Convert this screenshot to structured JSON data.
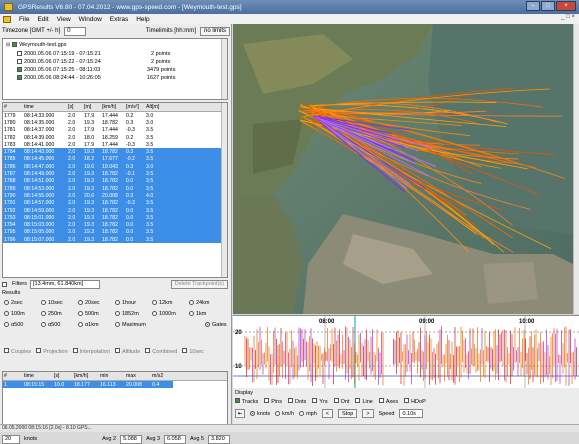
{
  "window": {
    "title": "GPSResults V6.80 - 07.04.2012 - www.gps-speed.com - [Weymouth-test.gps]"
  },
  "menu": {
    "items": [
      "File",
      "Edit",
      "View",
      "Window",
      "Extras",
      "Help"
    ],
    "right": "_ □ ×"
  },
  "timezone": {
    "label": "Timezone [GMT +/- h]",
    "value": "0",
    "timelimits": "Timelimits [hh:mm]",
    "nolimits": "no limits"
  },
  "tree": {
    "root": "Weymouth-test.gps",
    "tracks": [
      {
        "label": "2000.05.06 07:15:19 - 07:15:21",
        "points": "2 points"
      },
      {
        "label": "2000.05.06 07:15:22 - 07:15:24",
        "points": "2 points"
      },
      {
        "label": "2000.05.06 07:15:25 - 08:11:03",
        "points": "3479 points"
      },
      {
        "label": "2000.05.06 08:24:44 - 10:26:05",
        "points": "1627 points"
      }
    ]
  },
  "points_table": {
    "headers": [
      "#",
      "time",
      "[s]",
      "[m]",
      "[km/h]",
      "[m/s²]",
      "Alt[m]"
    ],
    "rows": [
      [
        "1779",
        "08:14:33.000",
        "2.0",
        "17.9",
        "17.444",
        "0.2",
        "3.0"
      ],
      [
        "1780",
        "08:14:35.000",
        "2.0",
        "19.3",
        "18.782",
        "0.3",
        "3.0"
      ],
      [
        "1781",
        "08:14:37.000",
        "2.0",
        "17.9",
        "17.444",
        "-0.3",
        "3.5"
      ],
      [
        "1782",
        "08:14:39.000",
        "2.0",
        "18.0",
        "18.259",
        "0.2",
        "3.5"
      ],
      [
        "1783",
        "08:14:41.000",
        "2.0",
        "17.9",
        "17.444",
        "-0.3",
        "3.5"
      ],
      [
        "1784",
        "08:14:43.000",
        "2.0",
        "19.3",
        "18.782",
        "0.3",
        "3.5"
      ],
      [
        "1785",
        "08:14:45.000",
        "2.0",
        "18.2",
        "17.677",
        "-0.2",
        "3.5"
      ],
      [
        "1786",
        "08:14:47.000",
        "2.0",
        "19.6",
        "19.043",
        "0.3",
        "3.0"
      ],
      [
        "1787",
        "08:14:49.000",
        "2.0",
        "19.3",
        "18.782",
        "-0.1",
        "3.5"
      ],
      [
        "1788",
        "08:14:51.000",
        "2.0",
        "19.3",
        "18.782",
        "0.0",
        "3.5"
      ],
      [
        "1789",
        "08:14:53.000",
        "2.0",
        "19.3",
        "18.782",
        "0.0",
        "3.5"
      ],
      [
        "1790",
        "08:14:55.000",
        "2.0",
        "20.6",
        "20.008",
        "0.3",
        "4.0"
      ],
      [
        "1791",
        "08:14:57.000",
        "2.0",
        "19.3",
        "18.782",
        "-0.3",
        "3.5"
      ],
      [
        "1792",
        "08:14:59.000",
        "2.0",
        "19.3",
        "18.782",
        "0.0",
        "3.5"
      ],
      [
        "1793",
        "08:15:01.000",
        "2.0",
        "19.3",
        "18.782",
        "0.0",
        "3.5"
      ],
      [
        "1794",
        "08:15:03.000",
        "2.0",
        "19.3",
        "18.782",
        "0.0",
        "3.5"
      ],
      [
        "1795",
        "08:15:05.000",
        "2.0",
        "19.3",
        "18.782",
        "0.0",
        "3.5"
      ],
      [
        "1796",
        "08:15:07.000",
        "2.0",
        "19.3",
        "18.782",
        "0.0",
        "3.5"
      ]
    ],
    "selected_from": 5
  },
  "filter": {
    "label": "Filters",
    "value": "[13.4mm, 61.840km]",
    "delete": "Delete Trackpoint(s)"
  },
  "results": {
    "label": "Results",
    "row1": [
      "2sec",
      "10sec",
      "20sec",
      "1hour",
      "12km",
      "24km"
    ],
    "row2": [
      "100m",
      "250m",
      "500m",
      "1852m",
      "1000m",
      "1km"
    ],
    "row3": [
      "α500",
      "α500",
      "α1km",
      "Maximum",
      "Gates"
    ],
    "checks": [
      "Couples",
      "Projection",
      "Interpolation",
      "Altitude",
      "Combined",
      "10sec"
    ]
  },
  "results_table": {
    "headers": [
      "#",
      "time",
      "[s]",
      "[km/h]",
      "min",
      "max",
      "m/s2"
    ],
    "row": [
      "1",
      "08:15:15",
      "10.0",
      "18.177",
      "16.113",
      "20.008",
      "0.4"
    ]
  },
  "bottom": {
    "count": "20",
    "unit": "knots",
    "avg2_label": "Avg 2",
    "avg2": "5.088",
    "avg3_label": "Avg 3",
    "avg3": "6.058",
    "avg5_label": "Avg 5",
    "avg5": "3.820"
  },
  "status": "06.05.2000 08:15:16 [2.0s] - 8.10 GPS...",
  "graph": {
    "time_labels": [
      "08:00",
      "09:00",
      "10:00"
    ],
    "y_labels": [
      "20",
      "10"
    ]
  },
  "display": {
    "label": "Display",
    "checks": [
      "Tracks",
      "Pins",
      "Dots",
      "Yrs",
      "Ont",
      "Line",
      "Axes",
      "HDoP"
    ],
    "units": [
      "knots",
      "km/h",
      "mph"
    ],
    "stop": "Stop",
    "speed_label": "Speed",
    "speed": "0.10s"
  },
  "colors": {
    "accent": "#3d8ee6",
    "tracks": "#ff8c00",
    "wind": "#8a2be2",
    "graph": "#e87000"
  }
}
